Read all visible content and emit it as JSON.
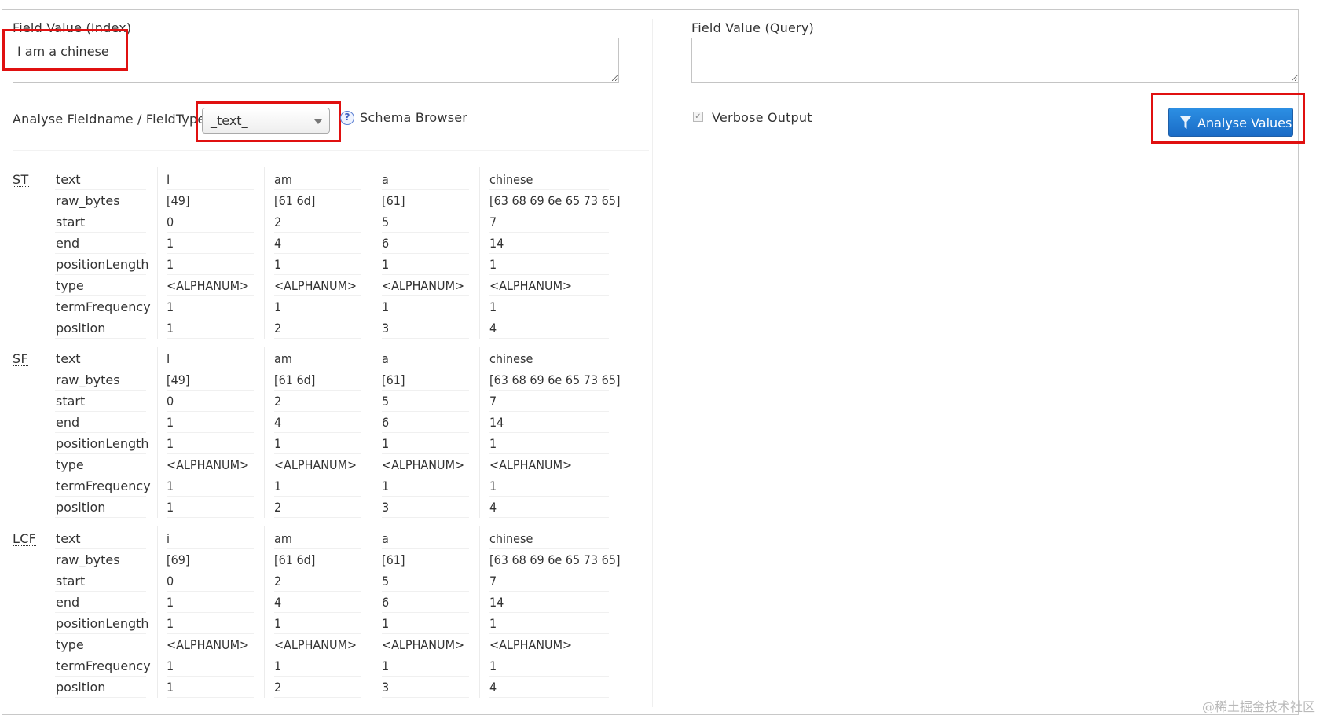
{
  "index_field": {
    "label": "Field Value (Index)",
    "value": "I am a chinese"
  },
  "query_field": {
    "label": "Field Value (Query)",
    "value": ""
  },
  "fieldtype": {
    "label": "Analyse Fieldname / FieldType:",
    "selected": "_text_",
    "schema_browser": "Schema Browser"
  },
  "verbose": {
    "label": "Verbose Output",
    "checked": true
  },
  "analyse_button": "Analyse Values",
  "attributes": [
    "text",
    "raw_bytes",
    "start",
    "end",
    "positionLength",
    "type",
    "termFrequency",
    "position"
  ],
  "stages": [
    {
      "abbr": "ST",
      "tokens": [
        [
          "I",
          "[49]",
          "0",
          "1",
          "1",
          "<ALPHANUM>",
          "1",
          "1"
        ],
        [
          "am",
          "[61 6d]",
          "2",
          "4",
          "1",
          "<ALPHANUM>",
          "1",
          "2"
        ],
        [
          "a",
          "[61]",
          "5",
          "6",
          "1",
          "<ALPHANUM>",
          "1",
          "3"
        ],
        [
          "chinese",
          "[63 68 69 6e 65 73 65]",
          "7",
          "14",
          "1",
          "<ALPHANUM>",
          "1",
          "4"
        ]
      ]
    },
    {
      "abbr": "SF",
      "tokens": [
        [
          "I",
          "[49]",
          "0",
          "1",
          "1",
          "<ALPHANUM>",
          "1",
          "1"
        ],
        [
          "am",
          "[61 6d]",
          "2",
          "4",
          "1",
          "<ALPHANUM>",
          "1",
          "2"
        ],
        [
          "a",
          "[61]",
          "5",
          "6",
          "1",
          "<ALPHANUM>",
          "1",
          "3"
        ],
        [
          "chinese",
          "[63 68 69 6e 65 73 65]",
          "7",
          "14",
          "1",
          "<ALPHANUM>",
          "1",
          "4"
        ]
      ]
    },
    {
      "abbr": "LCF",
      "tokens": [
        [
          "i",
          "[69]",
          "0",
          "1",
          "1",
          "<ALPHANUM>",
          "1",
          "1"
        ],
        [
          "am",
          "[61 6d]",
          "2",
          "4",
          "1",
          "<ALPHANUM>",
          "1",
          "2"
        ],
        [
          "a",
          "[61]",
          "5",
          "6",
          "1",
          "<ALPHANUM>",
          "1",
          "3"
        ],
        [
          "chinese",
          "[63 68 69 6e 65 73 65]",
          "7",
          "14",
          "1",
          "<ALPHANUM>",
          "1",
          "4"
        ]
      ]
    }
  ],
  "watermark": "@稀土掘金技术社区",
  "colors": {
    "highlight": "#e01010",
    "button": "#1a6bc6"
  }
}
